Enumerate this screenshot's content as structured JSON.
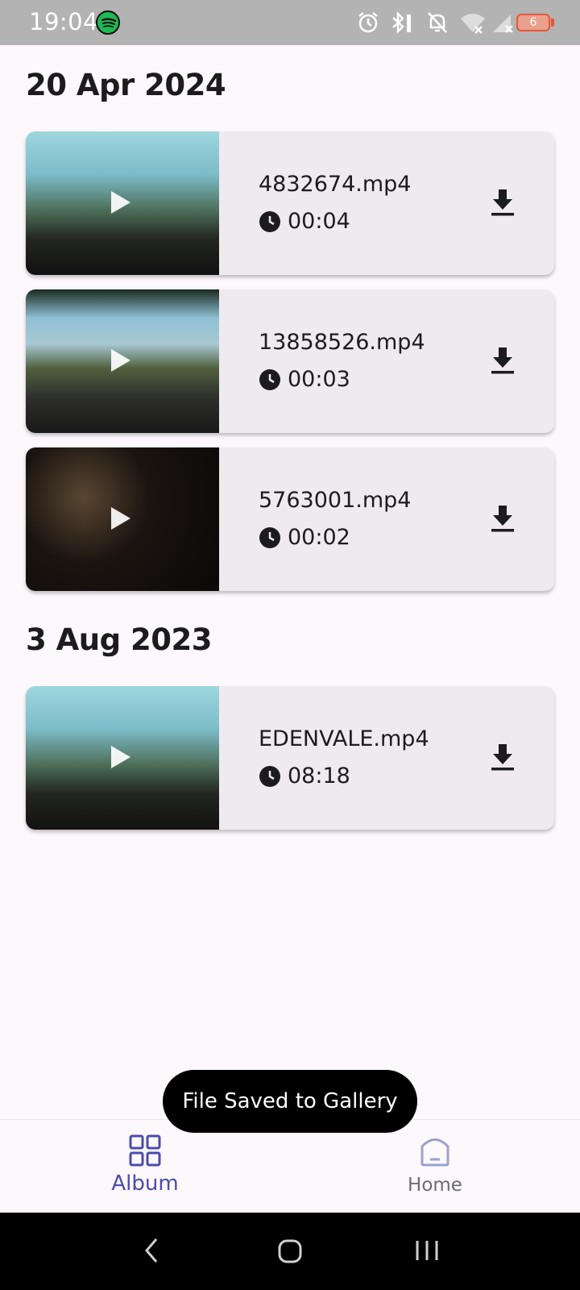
{
  "status_bar": {
    "time": "19:04",
    "battery_level": "6",
    "icons": [
      "spotify-icon",
      "alarm-icon",
      "bluetooth-icon",
      "mute-icon",
      "wifi-icon",
      "signal-icon",
      "battery-icon"
    ]
  },
  "sections": [
    {
      "date": "20 Apr 2024",
      "videos": [
        {
          "name": "4832674.mp4",
          "duration": "00:04"
        },
        {
          "name": "13858526.mp4",
          "duration": "00:03"
        },
        {
          "name": "5763001.mp4",
          "duration": "00:02"
        }
      ]
    },
    {
      "date": "3 Aug 2023",
      "videos": [
        {
          "name": "EDENVALE.mp4",
          "duration": "08:18"
        }
      ]
    }
  ],
  "toast": "File Saved to Gallery",
  "bottom_nav": {
    "album_label": "Album",
    "home_label": "Home"
  },
  "colors": {
    "accent": "#4a4cae",
    "background": "#fdf8fc",
    "card": "#eeeaf0"
  }
}
